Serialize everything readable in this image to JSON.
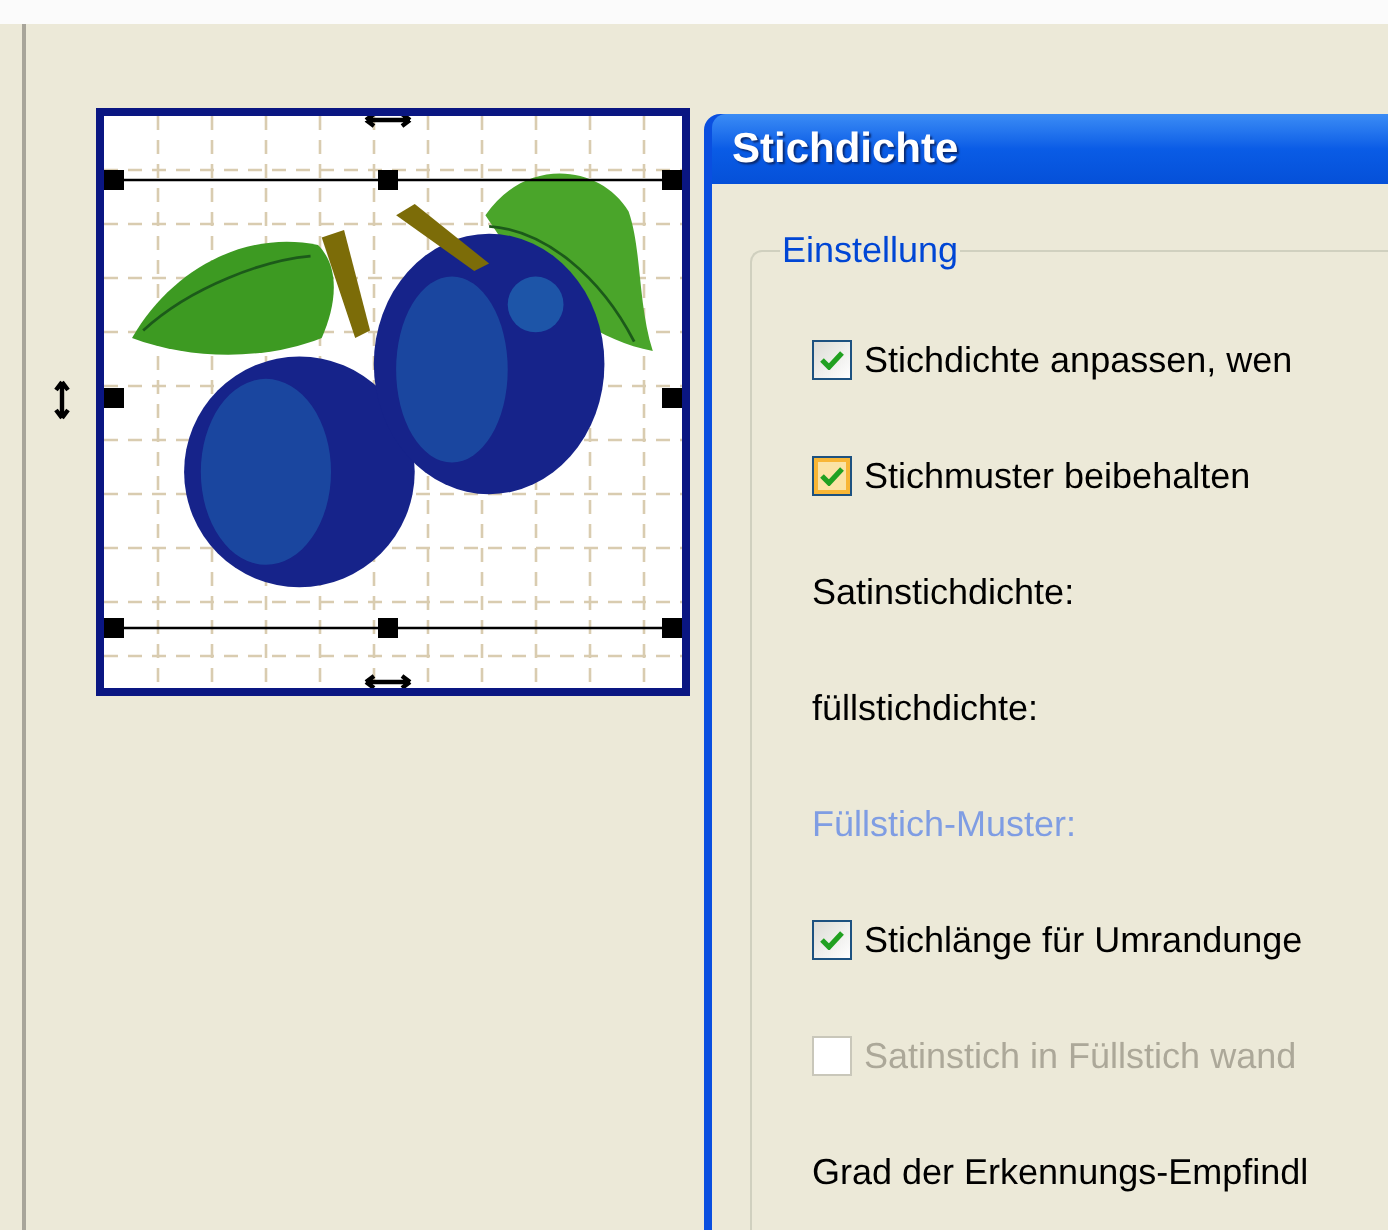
{
  "dialog": {
    "title": "Stichdichte",
    "group": {
      "title": "Einstellung",
      "items": [
        {
          "kind": "checkbox",
          "label": "Stichdichte anpassen, wen",
          "checked": true,
          "disabled": false,
          "hovered": false
        },
        {
          "kind": "checkbox",
          "label": "Stichmuster beibehalten",
          "checked": true,
          "disabled": false,
          "hovered": true
        },
        {
          "kind": "label",
          "label": "Satinstichdichte:",
          "disabled": false
        },
        {
          "kind": "label",
          "label": "füllstichdichte:",
          "disabled": false
        },
        {
          "kind": "label",
          "label": "Füllstich-Muster:",
          "disabled": true
        },
        {
          "kind": "checkbox",
          "label": "Stichlänge für Umrandunge",
          "checked": true,
          "disabled": false,
          "hovered": false
        },
        {
          "kind": "checkbox",
          "label": "Satinstich in Füllstich wand",
          "checked": false,
          "disabled": true,
          "hovered": false
        },
        {
          "kind": "label",
          "label": "Grad der Erkennungs-Empfindl",
          "disabled": false
        }
      ]
    }
  }
}
